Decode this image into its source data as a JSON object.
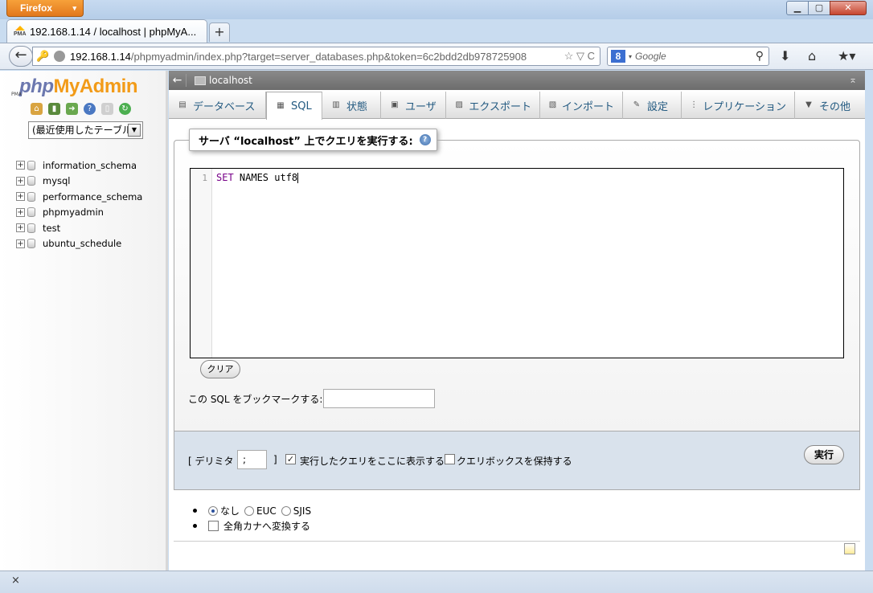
{
  "browser": {
    "menu_button": "Firefox",
    "menu_arrow": "▾",
    "window_min": "▁",
    "window_max": "▢",
    "window_close": "✕",
    "tab_title": "192.168.1.14 / localhost | phpMyA...",
    "favicon_text": "PMA",
    "new_tab": "+",
    "url_host": "192.168.1.14",
    "url_path": "/phpmyadmin/index.php?target=server_databases.php&token=6c2bdd2db978725908",
    "url_tools": "☆ ▽ C",
    "search_engine": "8",
    "search_arrow": "▾",
    "search_placeholder": "Google",
    "status_close": "×"
  },
  "sidebar": {
    "logo_php": "php",
    "logo_myadmin": "MyAdmin",
    "logo_small": "PMA",
    "recent_select": "(最近使用したテーブル",
    "databases": [
      "information_schema",
      "mysql",
      "performance_schema",
      "phpmyadmin",
      "test",
      "ubuntu_schedule"
    ]
  },
  "server_bar": {
    "title": "localhost",
    "back": "←",
    "collapse": "⌅"
  },
  "menu": {
    "tabs": [
      {
        "label": "データベース",
        "icon": "▤"
      },
      {
        "label": "SQL",
        "icon": "▦"
      },
      {
        "label": "状態",
        "icon": "▥"
      },
      {
        "label": "ユーザ",
        "icon": "▣"
      },
      {
        "label": "エクスポート",
        "icon": "▨"
      },
      {
        "label": "インポート",
        "icon": "▧"
      },
      {
        "label": "設定",
        "icon": "✎"
      },
      {
        "label": "レプリケーション",
        "icon": "⋮"
      },
      {
        "label": "その他",
        "icon": "▼"
      }
    ]
  },
  "query": {
    "legend": "サーバ “localhost” 上でクエリを実行する:",
    "help": "?",
    "line_number": "1",
    "code_keyword": "SET",
    "code_rest": " NAMES utf8",
    "clear_button": "クリア",
    "bookmark_label": "この SQL をブックマークする:",
    "bookmark_value": ""
  },
  "options": {
    "delimiter_open": "[ デリミタ",
    "delimiter_value": ";",
    "delimiter_close": "]",
    "show_query_label": "実行したクエリをここに表示する",
    "show_query_checked": "✓",
    "retain_box_label": "クエリボックスを保持する",
    "go_button": "実行"
  },
  "charset": {
    "none": "なし",
    "euc": "EUC",
    "sjis": "SJIS",
    "kana_label": "全角カナへ変換する"
  }
}
